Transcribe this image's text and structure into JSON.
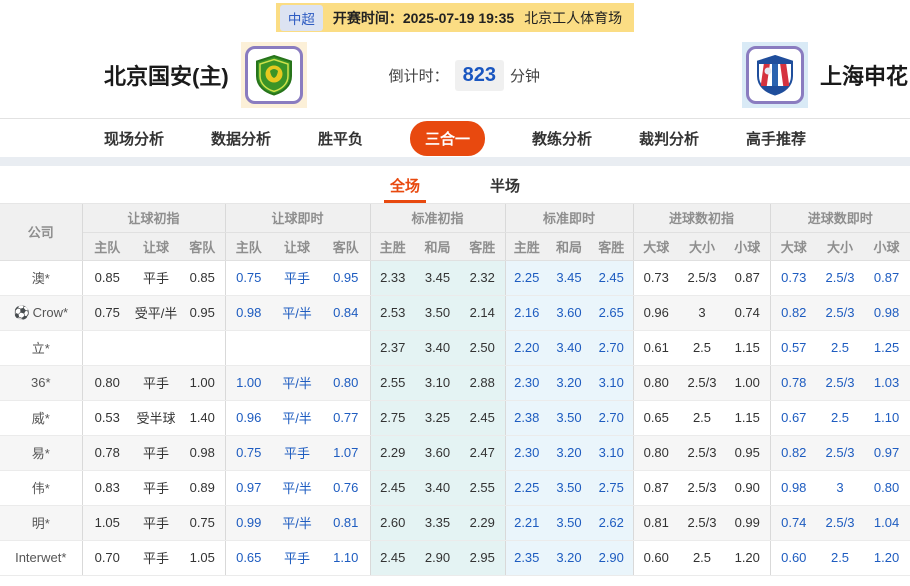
{
  "top_bar": {
    "league": "中超",
    "kickoff_label": "开赛时间：",
    "kickoff_time": "2025-07-19 19:35",
    "venue": "北京工人体育场"
  },
  "match_header": {
    "home_team": "北京国安(主)",
    "away_team": "上海申花",
    "home_logo_icon": "guoan-green-shield-crest",
    "away_logo_icon": "shenhua-blue-red-shield-crest",
    "countdown_label": "倒计时：",
    "countdown_value": "823",
    "countdown_unit": "分钟"
  },
  "tabs": {
    "items": [
      {
        "label": "现场分析",
        "active": false
      },
      {
        "label": "数据分析",
        "active": false
      },
      {
        "label": "胜平负",
        "active": false
      },
      {
        "label": "三合一",
        "active": true
      },
      {
        "label": "教练分析",
        "active": false
      },
      {
        "label": "裁判分析",
        "active": false
      },
      {
        "label": "高手推荐",
        "active": false
      }
    ]
  },
  "subtabs": {
    "items": [
      {
        "label": "全场",
        "active": true
      },
      {
        "label": "半场",
        "active": false
      }
    ]
  },
  "table": {
    "company_header": "公司",
    "groups": [
      {
        "label": "让球初指",
        "cols": [
          "主队",
          "让球",
          "客队"
        ]
      },
      {
        "label": "让球即时",
        "cols": [
          "主队",
          "让球",
          "客队"
        ]
      },
      {
        "label": "标准初指",
        "cols": [
          "主胜",
          "和局",
          "客胜"
        ]
      },
      {
        "label": "标准即时",
        "cols": [
          "主胜",
          "和局",
          "客胜"
        ]
      },
      {
        "label": "进球数初指",
        "cols": [
          "大球",
          "大小",
          "小球"
        ]
      },
      {
        "label": "进球数即时",
        "cols": [
          "大球",
          "大小",
          "小球"
        ]
      }
    ],
    "rows": [
      {
        "company": "澳*",
        "icon": null,
        "cells": [
          "0.85",
          "平手",
          "0.85",
          "0.75",
          "平手",
          "0.95",
          "2.33",
          "3.45",
          "2.32",
          "2.25",
          "3.45",
          "2.45",
          "0.73",
          "2.5/3",
          "0.87",
          "0.73",
          "2.5/3",
          "0.87"
        ]
      },
      {
        "company": "Crow*",
        "icon": "soccer-ball-icon",
        "cells": [
          "0.75",
          "受平/半",
          "0.95",
          "0.98",
          "平/半",
          "0.84",
          "2.53",
          "3.50",
          "2.14",
          "2.16",
          "3.60",
          "2.65",
          "0.96",
          "3",
          "0.74",
          "0.82",
          "2.5/3",
          "0.98"
        ]
      },
      {
        "company": "立*",
        "icon": null,
        "cells": [
          "",
          "",
          "",
          "",
          "",
          "",
          "2.37",
          "3.40",
          "2.50",
          "2.20",
          "3.40",
          "2.70",
          "0.61",
          "2.5",
          "1.15",
          "0.57",
          "2.5",
          "1.25"
        ]
      },
      {
        "company": "36*",
        "icon": null,
        "cells": [
          "0.80",
          "平手",
          "1.00",
          "1.00",
          "平/半",
          "0.80",
          "2.55",
          "3.10",
          "2.88",
          "2.30",
          "3.20",
          "3.10",
          "0.80",
          "2.5/3",
          "1.00",
          "0.78",
          "2.5/3",
          "1.03"
        ]
      },
      {
        "company": "威*",
        "icon": null,
        "cells": [
          "0.53",
          "受半球",
          "1.40",
          "0.96",
          "平/半",
          "0.77",
          "2.75",
          "3.25",
          "2.45",
          "2.38",
          "3.50",
          "2.70",
          "0.65",
          "2.5",
          "1.15",
          "0.67",
          "2.5",
          "1.10"
        ]
      },
      {
        "company": "易*",
        "icon": null,
        "cells": [
          "0.78",
          "平手",
          "0.98",
          "0.75",
          "平手",
          "1.07",
          "2.29",
          "3.60",
          "2.47",
          "2.30",
          "3.20",
          "3.10",
          "0.80",
          "2.5/3",
          "0.95",
          "0.82",
          "2.5/3",
          "0.97"
        ]
      },
      {
        "company": "伟*",
        "icon": null,
        "cells": [
          "0.83",
          "平手",
          "0.89",
          "0.97",
          "平/半",
          "0.76",
          "2.45",
          "3.40",
          "2.55",
          "2.25",
          "3.50",
          "2.75",
          "0.87",
          "2.5/3",
          "0.90",
          "0.98",
          "3",
          "0.80"
        ]
      },
      {
        "company": "明*",
        "icon": null,
        "cells": [
          "1.05",
          "平手",
          "0.75",
          "0.99",
          "平/半",
          "0.81",
          "2.60",
          "3.35",
          "2.29",
          "2.21",
          "3.50",
          "2.62",
          "0.81",
          "2.5/3",
          "0.99",
          "0.74",
          "2.5/3",
          "1.04"
        ]
      },
      {
        "company": "Interwet*",
        "icon": null,
        "cells": [
          "0.70",
          "平手",
          "1.05",
          "0.65",
          "平手",
          "1.10",
          "2.45",
          "2.90",
          "2.95",
          "2.35",
          "3.20",
          "2.90",
          "0.60",
          "2.5",
          "1.20",
          "0.60",
          "2.5",
          "1.20"
        ]
      }
    ]
  },
  "colors": {
    "accent_orange": "#e8490f",
    "live_odds_blue": "#1e5cc0",
    "topbar_yellow": "#fbdd84",
    "std_initial_bg": "#e4f3f3",
    "std_live_bg": "#eaf5fb",
    "countdown_blue": "#1a56c0"
  }
}
